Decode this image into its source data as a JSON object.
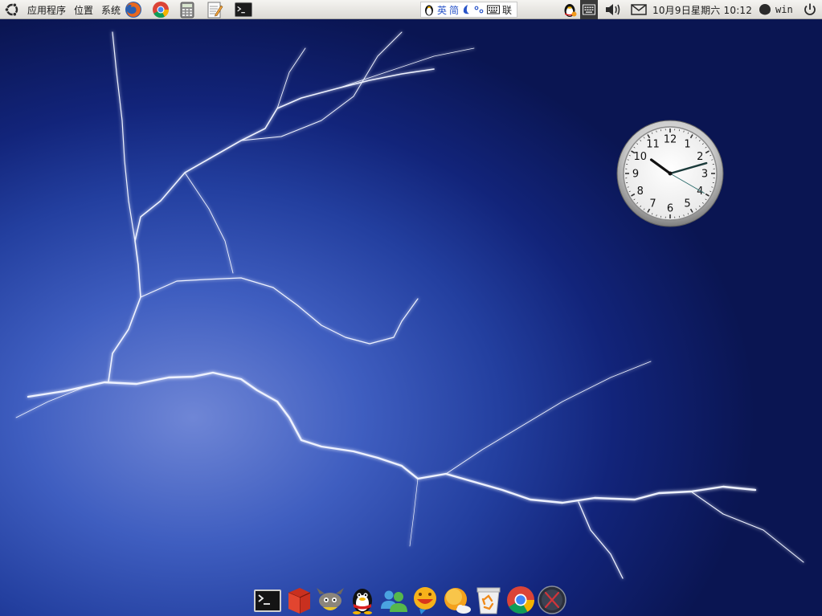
{
  "top_panel": {
    "menus": {
      "applications": "应用程序",
      "places": "位置",
      "system": "系统"
    },
    "launchers": [
      "firefox-icon",
      "chrome-icon",
      "calculator-icon",
      "text-editor-icon",
      "terminal-icon"
    ],
    "ime": {
      "lang": "英",
      "mode": "简",
      "indicator_3": "联"
    },
    "datetime": "10月9日星期六 10:12",
    "username": "win"
  },
  "clock_widget": {
    "numerals": [
      "12",
      "1",
      "2",
      "3",
      "4",
      "5",
      "6",
      "7",
      "8",
      "9",
      "10",
      "11"
    ],
    "time": {
      "hour": 10,
      "minute": 12,
      "second": 20
    }
  },
  "dock": {
    "items": [
      "terminal-icon",
      "package-icon",
      "gimp-icon",
      "qq-icon",
      "contacts-icon",
      "chat-icon",
      "weather-icon",
      "trash-icon",
      "chrome-icon",
      "x-app-icon"
    ]
  },
  "colors": {
    "panel": "#e6e4df",
    "wallpaper_dark": "#0a1552",
    "wallpaper_light": "#6f86d6"
  }
}
